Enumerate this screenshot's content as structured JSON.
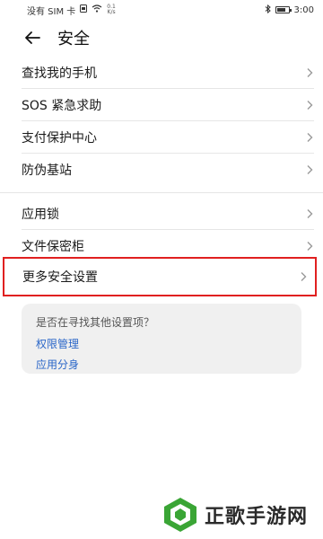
{
  "status": {
    "carrier": "没有 SIM 卡",
    "net_speed_value": "0.1",
    "net_speed_unit": "K/s",
    "time": "3:00",
    "battery_level": 0.8
  },
  "header": {
    "title": "安全"
  },
  "group1": [
    {
      "label": "查找我的手机"
    },
    {
      "label": "SOS 紧急求助"
    },
    {
      "label": "支付保护中心"
    },
    {
      "label": "防伪基站"
    }
  ],
  "group2": [
    {
      "label": "应用锁"
    },
    {
      "label": "文件保密柜"
    }
  ],
  "highlighted": {
    "label": "更多安全设置"
  },
  "suggest": {
    "question": "是否在寻找其他设置项？",
    "links": [
      "权限管理",
      "应用分身"
    ]
  },
  "watermark": {
    "text": "正歌手游网"
  }
}
